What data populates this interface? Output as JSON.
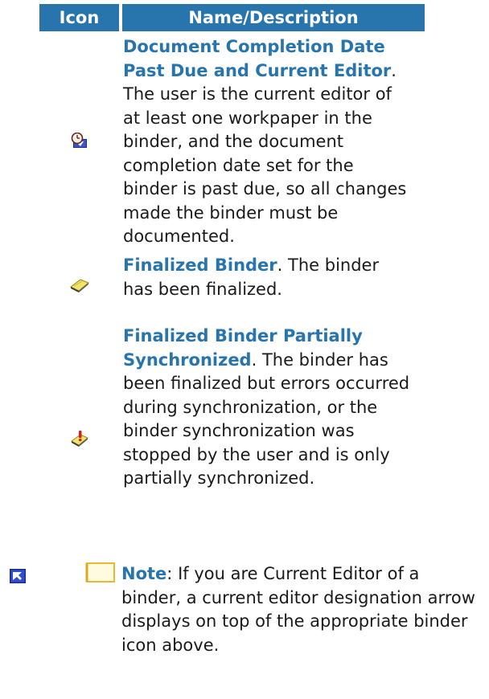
{
  "table": {
    "header": {
      "icon": "Icon",
      "name": "Name/Description"
    },
    "rows": [
      {
        "icon": "clock-arrow-icon",
        "title": "Document Completion Date Past Due and Current Editor",
        "description": "The user is the current editor of at least one workpaper in the binder, and the document completion date set for the binder is past due, so all changes made the binder must be documented."
      },
      {
        "icon": "finalized-binder-icon",
        "title": "Finalized Binder",
        "description": "The binder has been finalized."
      },
      {
        "icon": "finalized-binder-warning-icon",
        "title": "Finalized Binder Partially Synchronized",
        "description": "The binder has been finalized but errors occurred during synchronization, or the binder synchronization was stopped by the user and is only partially synchronized."
      }
    ]
  },
  "note": {
    "label": "Note",
    "text": "If you are Current Editor of a binder, a current editor designation arrow displays on top of the appropriate binder icon above."
  },
  "colors": {
    "accent": "#2874ad",
    "text": "#1a1a1a"
  }
}
